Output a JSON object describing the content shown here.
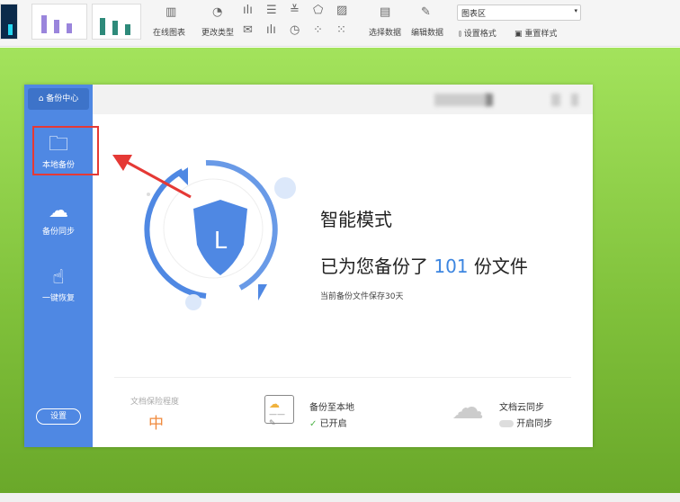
{
  "toolbar": {
    "online_chart": "在线图表",
    "change_type": "更改类型",
    "select_data": "选择数据",
    "edit_data": "编辑数据",
    "chart_area_select": "图表区",
    "set_format": "设置格式",
    "reset_style": "重置样式"
  },
  "sidebar": {
    "center": "备份中心",
    "items": [
      {
        "label": "本地备份"
      },
      {
        "label": "备份同步"
      },
      {
        "label": "一键恢复"
      }
    ],
    "settings": "设置"
  },
  "main": {
    "title": "智能模式",
    "stat_prefix": "已为您备份了",
    "stat_count": "101",
    "stat_suffix": "份文件",
    "note": "当前备份文件保存30天",
    "shield_letter": "L"
  },
  "footer": {
    "protection_label": "文档保险程度",
    "protection_value": "中",
    "local_title": "备份至本地",
    "local_status": "已开启",
    "cloud_title": "文档云同步",
    "cloud_toggle": "开启同步"
  },
  "colors": {
    "accent": "#4f88e3",
    "highlight": "#e53935",
    "level": "#f08a3c",
    "ok": "#52b44b"
  }
}
